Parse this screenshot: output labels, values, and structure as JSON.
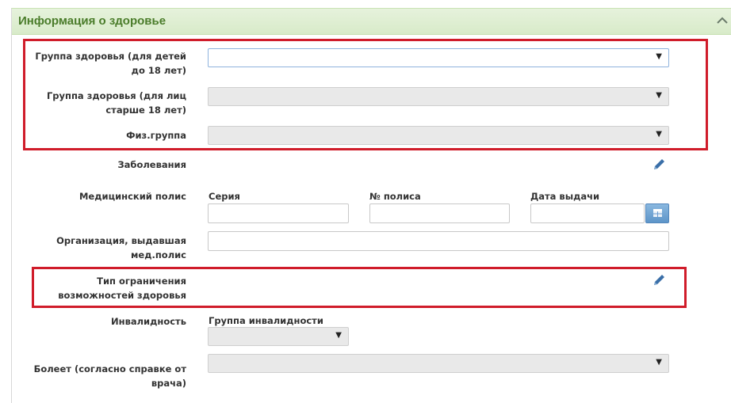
{
  "panel": {
    "title": "Информация о здоровье"
  },
  "fields": {
    "health_group_children": {
      "label": "Группа здоровья (для детей до 18 лет)",
      "value": ""
    },
    "health_group_adults": {
      "label": "Группа здоровья (для лиц старше 18 лет)",
      "value": ""
    },
    "phys_group": {
      "label": "Физ.группа",
      "value": ""
    },
    "diseases": {
      "label": "Заболевания"
    },
    "med_policy": {
      "label": "Медицинский полис",
      "series_label": "Серия",
      "number_label": "№ полиса",
      "issue_date_label": "Дата выдачи",
      "series_value": "",
      "number_value": "",
      "issue_date_value": ""
    },
    "issuing_org": {
      "label": "Организация, выдавшая мед.полис",
      "value": ""
    },
    "limitation_type": {
      "label": "Тип ограничения возможностей здоровья"
    },
    "disability": {
      "label": "Инвалидность",
      "group_label": "Группа инвалидности",
      "value": ""
    },
    "sick_certificate": {
      "label": "Болеет (согласно справке от врача)",
      "value": ""
    }
  },
  "icons": {
    "collapse": "chevron-up-icon",
    "edit": "pencil-icon",
    "calendar": "calendar-icon",
    "dropdown": "triangle-down"
  },
  "colors": {
    "header_bg": "#dcedce",
    "header_text": "#4a7c2a",
    "highlight": "#d01c2a",
    "edit_icon": "#3a6fa8"
  }
}
